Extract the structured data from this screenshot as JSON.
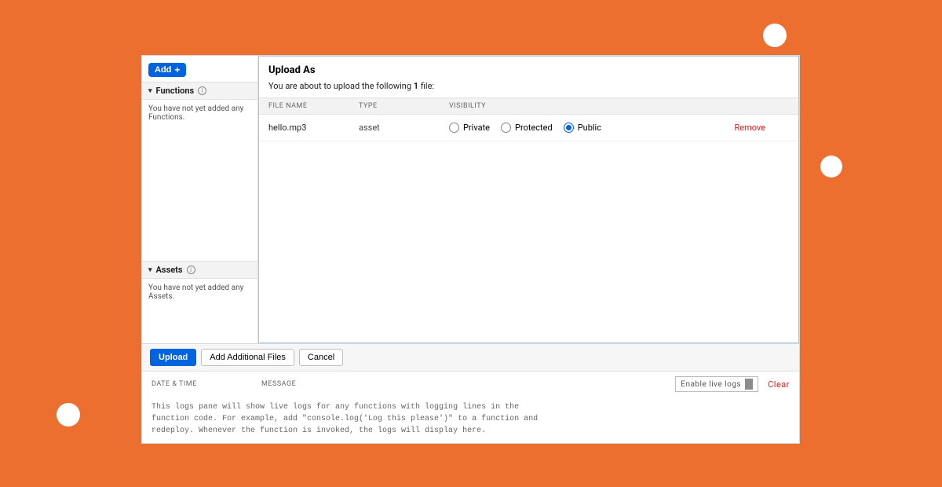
{
  "sidebar": {
    "add_label": "Add",
    "functions_label": "Functions",
    "functions_empty": "You have not yet added any Functions.",
    "assets_label": "Assets",
    "assets_empty": "You have not yet added any Assets."
  },
  "upload": {
    "heading": "Upload As",
    "sentence_pre": "You are about to upload the following ",
    "count": "1",
    "sentence_post": " file:",
    "cols": {
      "name": "FILE NAME",
      "type": "TYPE",
      "visibility": "VISIBILITY"
    },
    "row": {
      "name": "hello.mp3",
      "type": "asset",
      "options": {
        "private": "Private",
        "protected": "Protected",
        "public": "Public"
      },
      "remove": "Remove"
    }
  },
  "actions": {
    "upload": "Upload",
    "add_files": "Add Additional Files",
    "cancel": "Cancel"
  },
  "logs": {
    "cols": {
      "date": "DATE & TIME",
      "message": "MESSAGE"
    },
    "enable": "Enable live logs",
    "clear": "Clear",
    "body": "This logs pane will show live logs for any functions with logging lines in the function code. For example, add \"console.log('Log this please')\" to a function and redeploy. Whenever the function is invoked, the logs will display here."
  }
}
